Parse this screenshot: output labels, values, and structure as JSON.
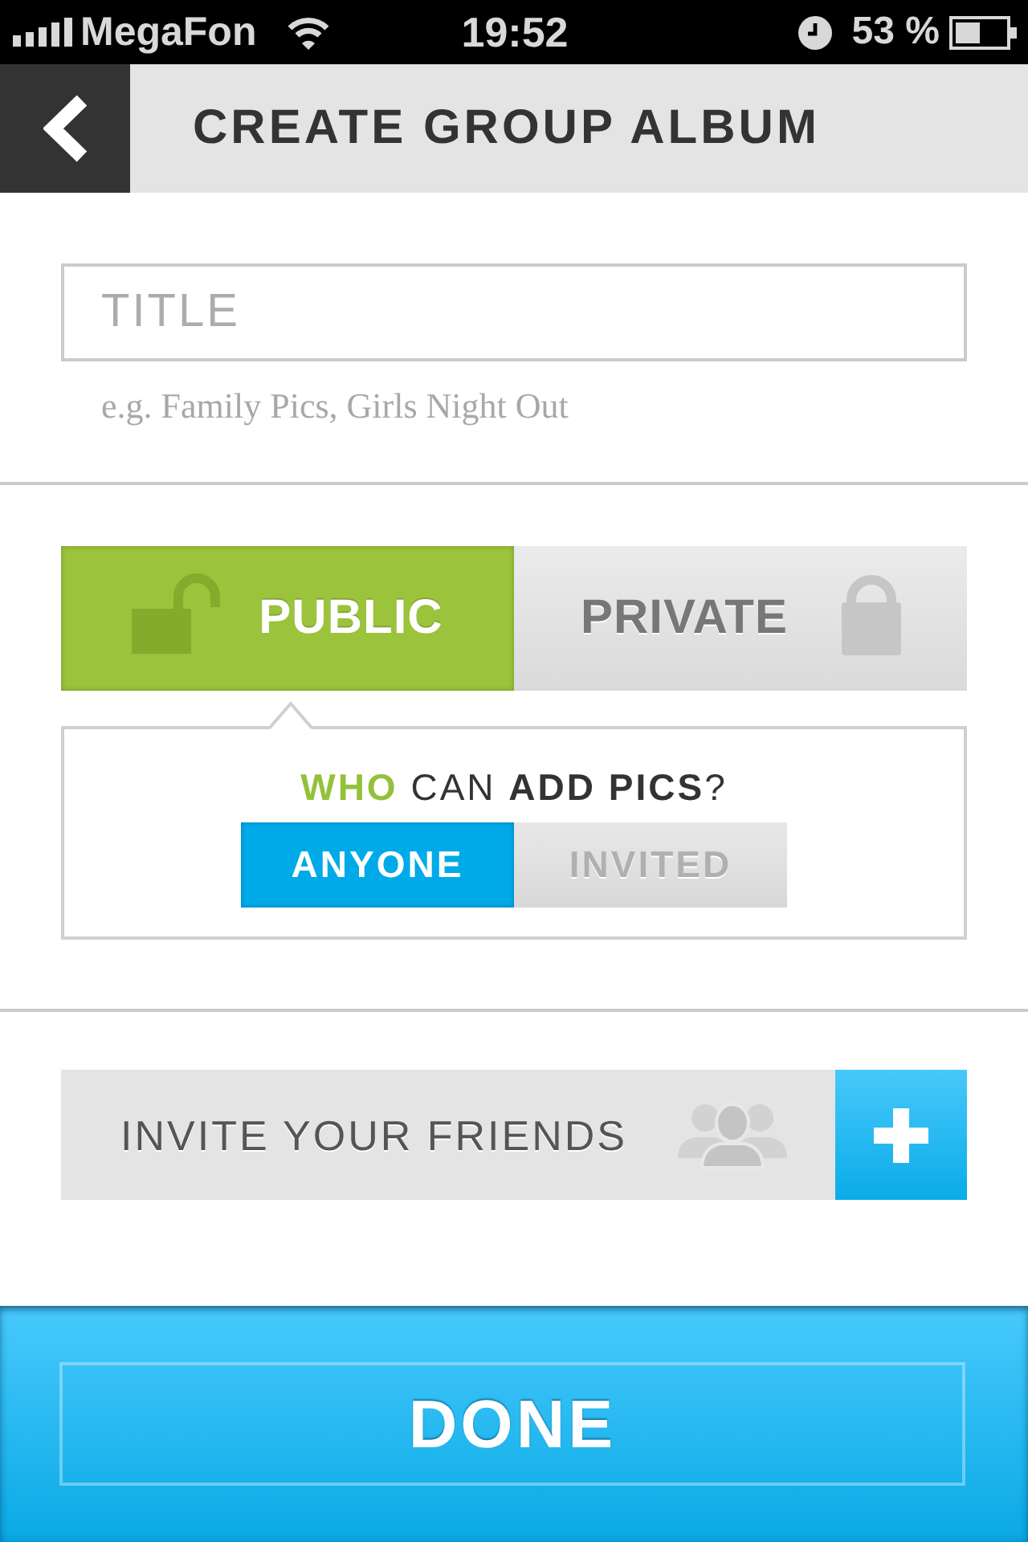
{
  "status_bar": {
    "carrier": "MegaFon",
    "time": "19:52",
    "battery": "53 %"
  },
  "header": {
    "title": "CREATE GROUP ALBUM"
  },
  "title_field": {
    "placeholder": "TITLE",
    "hint": "e.g. Family Pics, Girls Night Out"
  },
  "privacy_tabs": [
    {
      "label": "PUBLIC",
      "kind": "public",
      "selected": true
    },
    {
      "label": "PRIVATE",
      "kind": "private",
      "selected": false
    }
  ],
  "who_can_add": {
    "question": "**WHO** CAN **ADD PICS**?",
    "options": [
      {
        "label": "ANYONE",
        "selected": true
      },
      {
        "label": "INVITED",
        "selected": false
      }
    ]
  },
  "invite": {
    "label": "INVITE YOUR FRIENDS"
  },
  "done_button": {
    "label": "DONE"
  }
}
